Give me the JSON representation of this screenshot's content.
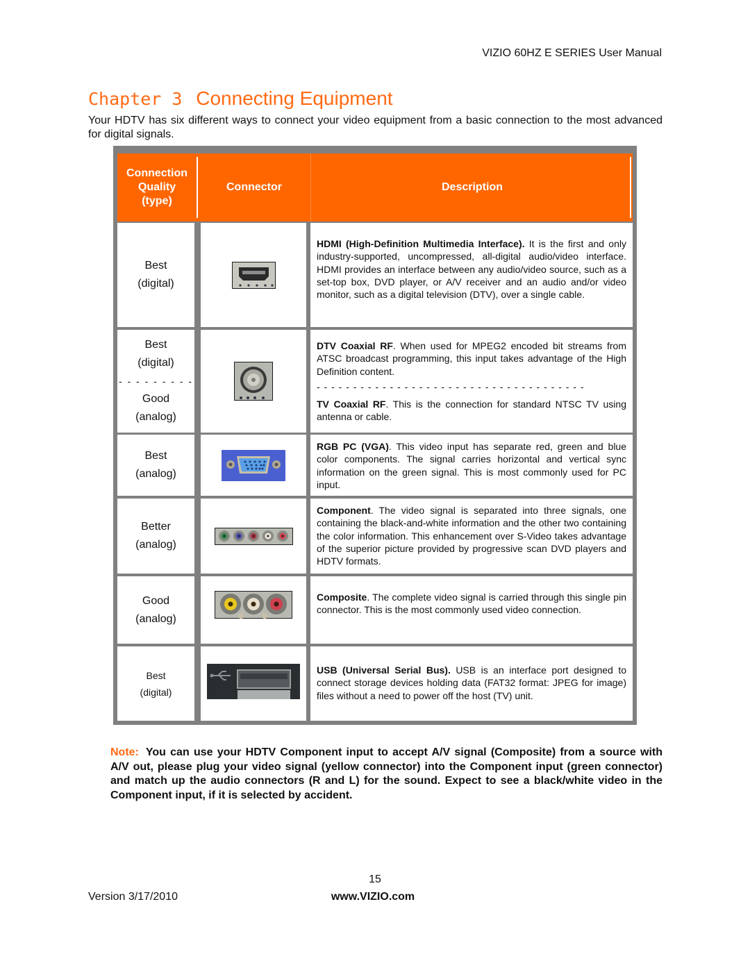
{
  "header": {
    "running_title": "VIZIO 60HZ E SERIES User Manual"
  },
  "chapter": {
    "label": "Chapter 3",
    "title": "Connecting Equipment"
  },
  "intro": "Your HDTV has six different ways to connect your video equipment from a basic connection to the most advanced for digital signals.",
  "table": {
    "headers": {
      "quality_line1": "Connection",
      "quality_line2": "Quality",
      "quality_line3": "(type)",
      "connector": "Connector",
      "description": "Description"
    },
    "colors": {
      "header_bg": "#ff6600",
      "border": "#808080"
    },
    "rows": [
      {
        "quality": "Best",
        "type": "(digital)",
        "connector_icon": "hdmi-port-icon",
        "desc_bold": "HDMI (High-Definition Multimedia Interface).",
        "desc_text": " It is the first and only industry-supported, uncompressed, all-digital audio/video interface. HDMI provides an interface between any audio/video source, such as a set-top box, DVD player, or A/V receiver and an audio and/or video monitor, such as a digital television (DTV), over a single cable."
      },
      {
        "quality": "Best",
        "type": "(digital)",
        "separator": "- - - - - - - - -",
        "quality2": "Good",
        "type2": "(analog)",
        "connector_icon": "coaxial-rf-port-icon",
        "desc_bold": "DTV Coaxial RF",
        "desc_text": ".  When used for MPEG2 encoded bit streams from ATSC broadcast programming, this input takes advantage of the High Definition content.",
        "desc_separator": "- - - - - - - - - - - - - - - - - - - - - - - - - - - - - - - - - - - - -",
        "desc2_bold": "TV Coaxial RF",
        "desc2_text": ". This is the connection for standard NTSC TV using antenna or cable."
      },
      {
        "quality": "Best",
        "type": "(analog)",
        "connector_icon": "vga-port-icon",
        "desc_bold": "RGB PC (VGA)",
        "desc_text": ". This video input has separate red, green and blue color components.  The signal carries horizontal and vertical sync information on the green signal.  This is most commonly used for PC input."
      },
      {
        "quality": "Better",
        "type": "(analog)",
        "connector_icon": "component-ports-icon",
        "desc_bold": "Component",
        "desc_text": ". The video signal is separated into three signals, one containing the black-and-white information and the other two containing the color information. This enhancement over S-Video takes advantage of the superior picture provided by progressive scan DVD players and HDTV formats."
      },
      {
        "quality": "Good",
        "type": "(analog)",
        "connector_icon": "composite-ports-icon",
        "desc_bold": "Composite",
        "desc_text": ". The complete video signal is carried through this single pin connector. This is the most commonly used video connection."
      },
      {
        "quality": "Best",
        "type": "(digital)",
        "connector_icon": "usb-port-icon",
        "desc_bold": "USB (Universal Serial Bus).",
        "desc_text": " USB is an interface port designed to connect storage devices holding data (FAT32 format: JPEG for image) files without a need to power off the host (TV) unit."
      }
    ]
  },
  "note": {
    "label": "Note:",
    "text": "You can use your HDTV Component input to accept A/V signal (Composite) from a source with A/V out, please plug your video signal (yellow connector) into the Component input (green connector) and match up the audio connectors (R and L) for the sound. Expect to see a black/white video in the Component input, if it is selected by accident."
  },
  "footer": {
    "page_number": "15",
    "version": "Version 3/17/2010",
    "website": "www.VIZIO.com"
  },
  "accent_color": "#ff6a13"
}
